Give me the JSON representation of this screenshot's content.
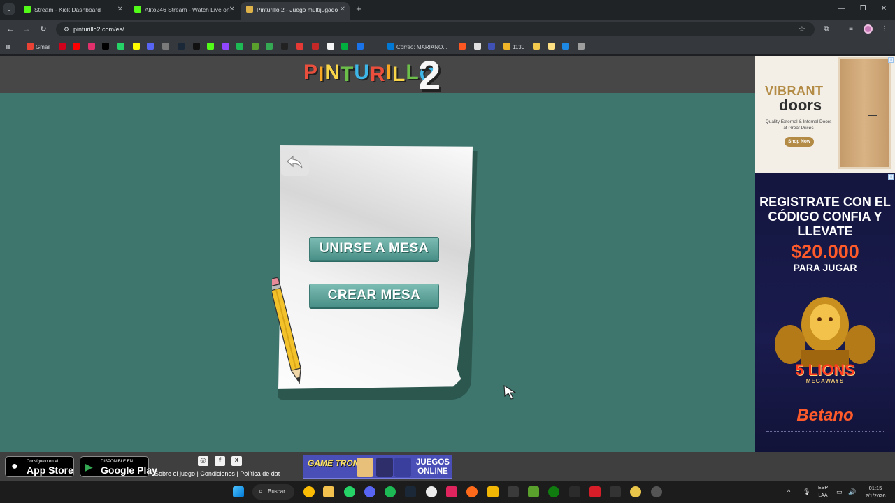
{
  "browser": {
    "tabs": [
      {
        "title": "Stream - Kick Dashboard",
        "favicon_color": "#53fc18",
        "active": false
      },
      {
        "title": "Alito246 Stream - Watch Live on",
        "favicon_color": "#53fc18",
        "active": false
      },
      {
        "title": "Pinturillo 2 - Juego multijugado",
        "favicon_color": "#e0b34a",
        "active": true
      }
    ],
    "url": "pinturillo2.com/es/",
    "bookmarks": [
      {
        "label": "Gmail",
        "color": "#ea4335"
      },
      {
        "label": "",
        "color": "#d0021b"
      },
      {
        "label": "",
        "color": "#ff0000"
      },
      {
        "label": "",
        "color": "#e1306c"
      },
      {
        "label": "",
        "color": "#000000"
      },
      {
        "label": "",
        "color": "#25d366"
      },
      {
        "label": "",
        "color": "#fffc00"
      },
      {
        "label": "",
        "color": "#5865f2"
      },
      {
        "label": "",
        "color": "#7a7a7a"
      },
      {
        "label": "",
        "color": "#1b2838"
      },
      {
        "label": "",
        "color": "#111111"
      },
      {
        "label": "",
        "color": "#53fc18"
      },
      {
        "label": "",
        "color": "#9146ff"
      },
      {
        "label": "",
        "color": "#1db954"
      },
      {
        "label": "",
        "color": "#5aa02c"
      },
      {
        "label": "",
        "color": "#34a853"
      },
      {
        "label": "",
        "color": "#222222"
      },
      {
        "label": "",
        "color": "#e53935"
      },
      {
        "label": "",
        "color": "#c62828"
      },
      {
        "label": "",
        "color": "#f5f5f5"
      },
      {
        "label": "",
        "color": "#00b140"
      },
      {
        "label": "",
        "color": "#1a73e8"
      },
      {
        "label": "Correo: MARIANO...",
        "color": "#0078d4"
      },
      {
        "label": "",
        "color": "#ff5722"
      },
      {
        "label": "",
        "color": "#e0e0e0"
      },
      {
        "label": "",
        "color": "#3f51b5"
      },
      {
        "label": "1130",
        "color": "#f0b429"
      },
      {
        "label": "",
        "color": "#f2c94c"
      },
      {
        "label": "",
        "color": "#ffe082"
      },
      {
        "label": "",
        "color": "#1e88e5"
      },
      {
        "label": "",
        "color": "#9e9e9e"
      }
    ]
  },
  "game": {
    "logo_letters": [
      {
        "ch": "P",
        "color": "#e94f3c"
      },
      {
        "ch": "I",
        "color": "#f6a623"
      },
      {
        "ch": "N",
        "color": "#f8d548"
      },
      {
        "ch": "T",
        "color": "#6cc04a"
      },
      {
        "ch": "U",
        "color": "#3fb6e8"
      },
      {
        "ch": "R",
        "color": "#e94f3c"
      },
      {
        "ch": "I",
        "color": "#f6a623"
      },
      {
        "ch": "L",
        "color": "#f8d548"
      },
      {
        "ch": "L",
        "color": "#6cc04a"
      },
      {
        "ch": "O",
        "color": "#3fb6e8"
      }
    ],
    "logo_number": "2",
    "join_label": "UNIRSE A MESA",
    "create_label": "CREAR MESA",
    "back_icon": "back-arrow-icon"
  },
  "ads": {
    "doors": {
      "line1": "VIBRANT",
      "line2": "doors",
      "line3": "Quality External & Internal Doors at Great Prices",
      "cta": "Shop Now"
    },
    "betano": {
      "line1": "REGISTRATE CON EL CÓDIGO CONFIA Y LLEVATE",
      "amount": "$20.000",
      "line3": "PARA JUGAR",
      "game": "5 LIONS",
      "game_sub": "MEGAWAYS",
      "brand": "Betano"
    }
  },
  "footer": {
    "appstore_small": "Consíguelo en el",
    "appstore_big": "App Store",
    "googleplay_small": "DISPONIBLE EN",
    "googleplay_big": "Google Play",
    "links": "Sobre el juego | Condiciones | Política de dat",
    "gametronia_brand": "GAME TRONIA",
    "gametronia_text": "JUEGOS ONLINE"
  },
  "taskbar": {
    "search_label": "Buscar",
    "lang_line1": "ESP",
    "lang_line2": "LAA",
    "time": "01:15",
    "date": "2/1/2026"
  }
}
